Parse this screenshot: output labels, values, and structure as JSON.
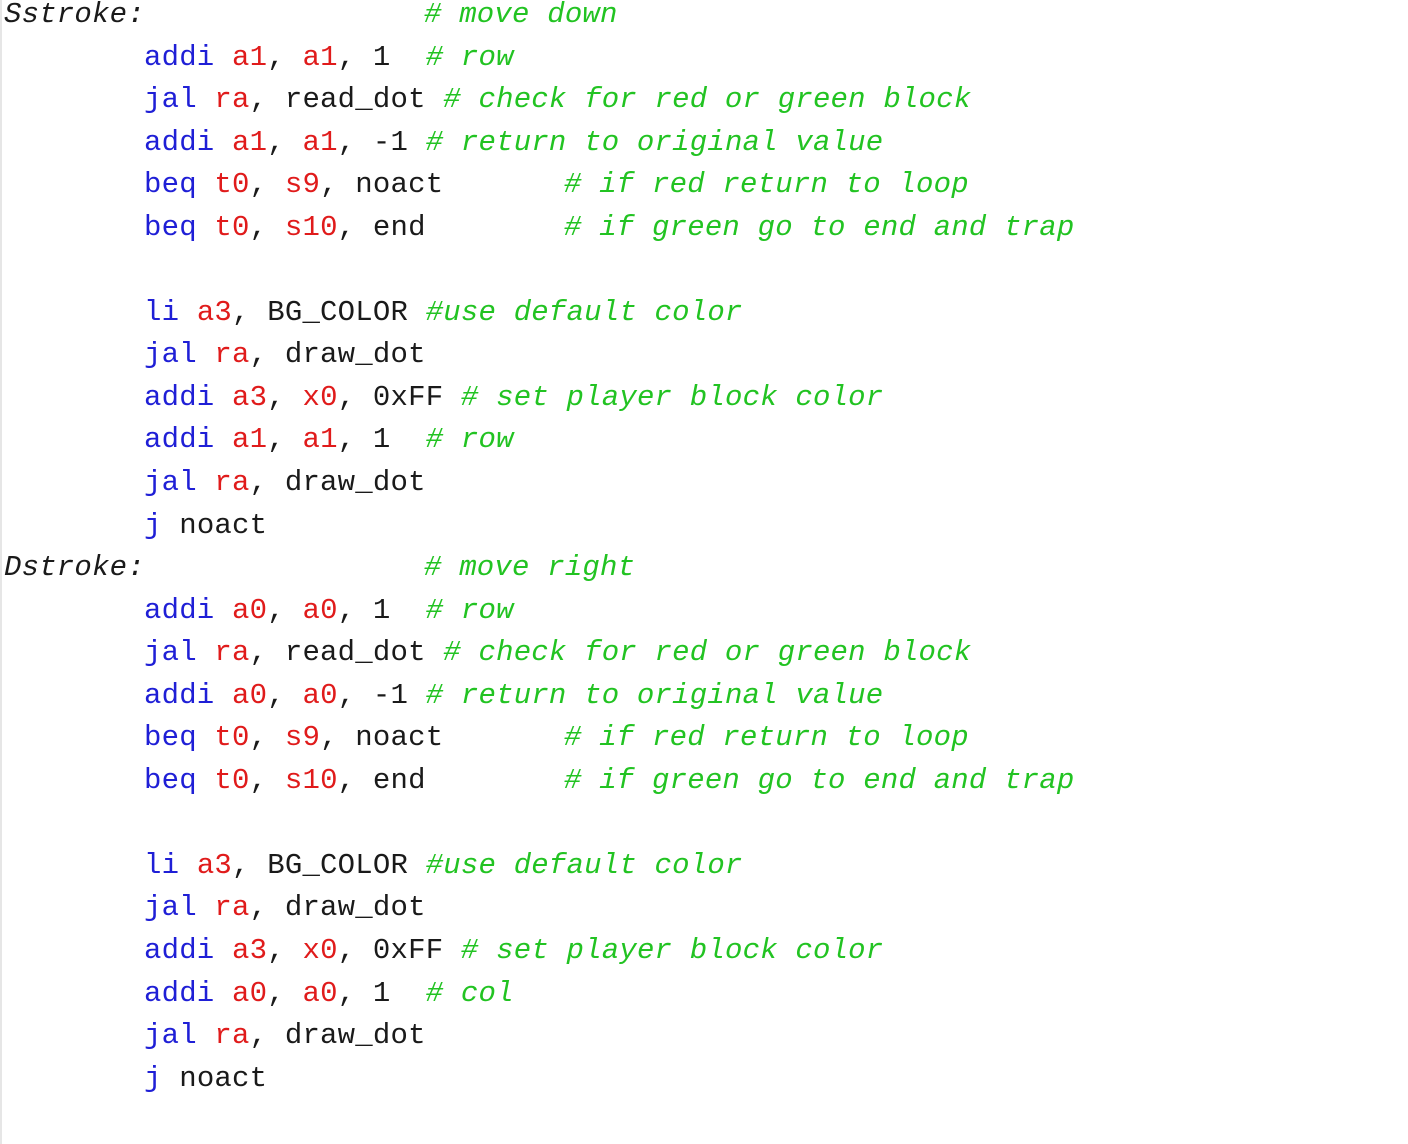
{
  "colors": {
    "opcode": "#1f1fd6",
    "register": "#e01b1b",
    "comment": "#22c322",
    "text": "#1a1a1a",
    "background": "#ffffff"
  },
  "lines": [
    {
      "label": "Sstroke:",
      "comment": "# move down"
    },
    {
      "op": "addi",
      "r1": "a1",
      "sep1": ", ",
      "r2": "a1",
      "rest": ", 1  ",
      "comment": "# row"
    },
    {
      "op": "jal",
      "r1": "ra",
      "rest": ", read_dot ",
      "comment": "# check for red or green block"
    },
    {
      "op": "addi",
      "r1": "a1",
      "sep1": ", ",
      "r2": "a1",
      "rest": ", -1 ",
      "comment": "# return to original value"
    },
    {
      "op": "beq",
      "r1": "t0",
      "sep1": ", ",
      "r2": "s9",
      "rest": ", noact",
      "comment": "# if red return to loop"
    },
    {
      "op": "beq",
      "r1": "t0",
      "sep1": ", ",
      "r2": "s10",
      "rest": ", end",
      "comment": "# if green go to end and trap"
    },
    {
      "blank": true
    },
    {
      "op": "li",
      "r1": "a3",
      "rest": ", BG_COLOR ",
      "comment": "#use default color"
    },
    {
      "op": "jal",
      "r1": "ra",
      "rest": ", draw_dot"
    },
    {
      "op": "addi",
      "r1": "a3",
      "sep1": ", ",
      "r2": "x0",
      "rest": ", 0xFF ",
      "comment": "# set player block color"
    },
    {
      "op": "addi",
      "r1": "a1",
      "sep1": ", ",
      "r2": "a1",
      "rest": ", 1  ",
      "comment": "# row"
    },
    {
      "op": "jal",
      "r1": "ra",
      "rest": ", draw_dot"
    },
    {
      "op": "j",
      "rest": " noact"
    },
    {
      "label": "Dstroke:",
      "comment": "# move right"
    },
    {
      "op": "addi",
      "r1": "a0",
      "sep1": ", ",
      "r2": "a0",
      "rest": ", 1  ",
      "comment": "# row"
    },
    {
      "op": "jal",
      "r1": "ra",
      "rest": ", read_dot ",
      "comment": "# check for red or green block"
    },
    {
      "op": "addi",
      "r1": "a0",
      "sep1": ", ",
      "r2": "a0",
      "rest": ", -1 ",
      "comment": "# return to original value"
    },
    {
      "op": "beq",
      "r1": "t0",
      "sep1": ", ",
      "r2": "s9",
      "rest": ", noact",
      "comment": "# if red return to loop"
    },
    {
      "op": "beq",
      "r1": "t0",
      "sep1": ", ",
      "r2": "s10",
      "rest": ", end",
      "comment": "# if green go to end and trap"
    },
    {
      "blank": true
    },
    {
      "op": "li",
      "r1": "a3",
      "rest": ", BG_COLOR ",
      "comment": "#use default color"
    },
    {
      "op": "jal",
      "r1": "ra",
      "rest": ", draw_dot"
    },
    {
      "op": "addi",
      "r1": "a3",
      "sep1": ", ",
      "r2": "x0",
      "rest": ", 0xFF ",
      "comment": "# set player block color"
    },
    {
      "op": "addi",
      "r1": "a0",
      "sep1": ", ",
      "r2": "a0",
      "rest": ", 1  ",
      "comment": "# col"
    },
    {
      "op": "jal",
      "r1": "ra",
      "rest": ", draw_dot"
    },
    {
      "op": "j",
      "rest": " noact"
    }
  ]
}
